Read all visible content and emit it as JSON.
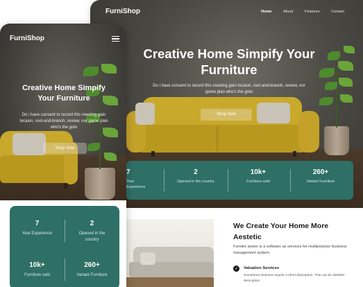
{
  "brand": "FurniShop",
  "desktop": {
    "nav": [
      "Home",
      "About",
      "Features",
      "Contact"
    ],
    "hero_title": "Creative Home Simpify Your Furniture",
    "hero_subtitle": "Do i have consent to record this meeting gain locaion, root-and-branch, review, nor game plan who's the goto",
    "cta": "Shop Now",
    "stats": [
      {
        "value": "7",
        "label": "Year Experience"
      },
      {
        "value": "2",
        "label": "Opened in the country"
      },
      {
        "value": "10k+",
        "label": "Furniture sold"
      },
      {
        "value": "260+",
        "label": "Variant Furniture"
      }
    ],
    "section_title": "We Create Your Home More Aestetic",
    "section_desc": "Furnitre power is a software as services for multiperpose business management system.",
    "feature_title": "Valuation Services",
    "feature_desc": "Sometimes features require a short description. This can be detailed description"
  },
  "mobile": {
    "hero_title": "Creative Home Simpify Your Furniture",
    "hero_subtitle": "Do i have consent to record this meeting gain locaion, root-and-branch, review, nor game plan who's the goto",
    "cta": "Shop Now",
    "stats": [
      {
        "value": "7",
        "label": "Year Experience"
      },
      {
        "value": "2",
        "label": "Opened in the country"
      },
      {
        "value": "10k+",
        "label": "Furniture sold"
      },
      {
        "value": "260+",
        "label": "Variant Furniture"
      }
    ]
  },
  "colors": {
    "accent": "#2e6f66",
    "sofa": "#c9a92c",
    "dark": "#3a3834"
  }
}
